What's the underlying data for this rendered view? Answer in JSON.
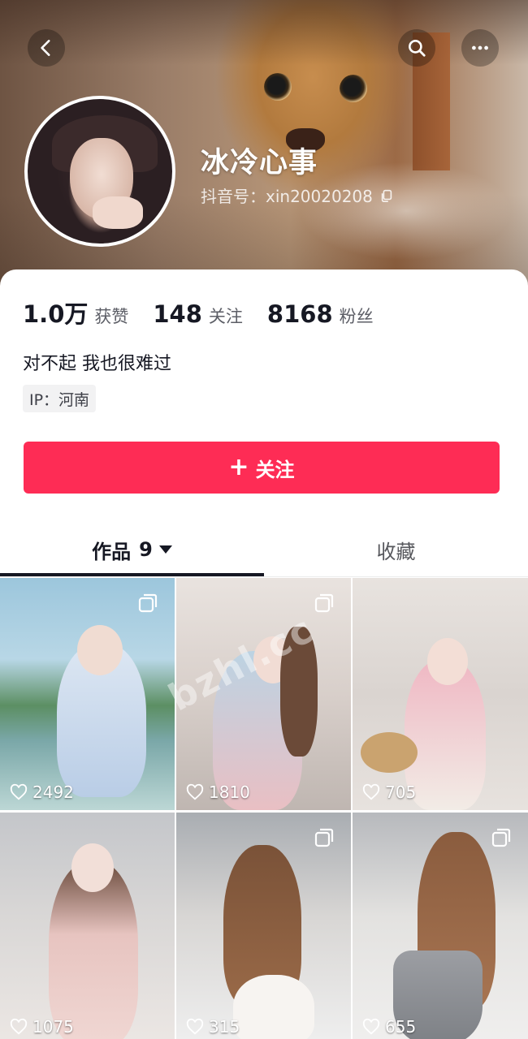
{
  "header": {
    "nickname": "冰冷心事",
    "douyin_id": "抖音号：xin20020208"
  },
  "stats": [
    {
      "value": "1.0万",
      "label": "获赞"
    },
    {
      "value": "148",
      "label": "关注"
    },
    {
      "value": "8168",
      "label": "粉丝"
    }
  ],
  "bio": "对不起 我也很难过",
  "ip": "IP：河南",
  "follow_button": {
    "label": "关注",
    "color": "#fe2c55"
  },
  "tabs": {
    "works_label": "作品",
    "works_count": "9",
    "favorites_label": "收藏"
  },
  "posts": [
    {
      "likes": "2492",
      "multi_image": true
    },
    {
      "likes": "1810",
      "multi_image": true
    },
    {
      "likes": "705",
      "multi_image": false
    },
    {
      "likes": "1075",
      "multi_image": false
    },
    {
      "likes": "315",
      "multi_image": true
    },
    {
      "likes": "655",
      "multi_image": true
    }
  ],
  "watermark": "bzhl.cc",
  "icons": [
    "back-icon",
    "search-icon",
    "more-icon",
    "copy-icon",
    "plus-icon",
    "caret-down-icon",
    "heart-icon",
    "multi-image-icon"
  ]
}
